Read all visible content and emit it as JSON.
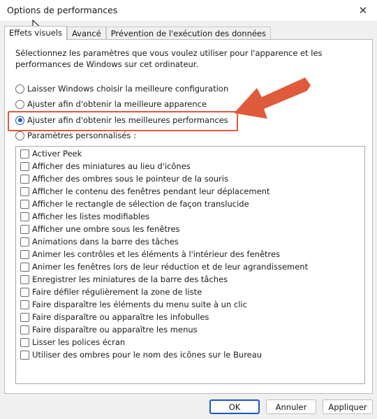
{
  "window": {
    "title": "Options de performances",
    "close_icon": "close-icon"
  },
  "tabs": [
    {
      "label": "Effets visuels",
      "active": true
    },
    {
      "label": "Avancé",
      "active": false
    },
    {
      "label": "Prévention de l'exécution des données",
      "active": false
    }
  ],
  "intro": "Sélectionnez les paramètres que vous voulez utiliser pour l'apparence et les performances de Windows sur cet ordinateur.",
  "options": [
    {
      "label": "Laisser Windows choisir la meilleure configuration",
      "selected": false
    },
    {
      "label": "Ajuster afin d'obtenir la meilleure apparence",
      "selected": false
    },
    {
      "label": "Ajuster afin d'obtenir les meilleures performances",
      "selected": true
    },
    {
      "label": "Paramètres personnalisés :",
      "selected": false
    }
  ],
  "effects": [
    {
      "label": "Activer Peek",
      "checked": false
    },
    {
      "label": "Afficher des miniatures au lieu d'icônes",
      "checked": false
    },
    {
      "label": "Afficher des ombres sous le pointeur de la souris",
      "checked": false
    },
    {
      "label": "Afficher le contenu des fenêtres pendant leur déplacement",
      "checked": false
    },
    {
      "label": "Afficher le rectangle de sélection de façon translucide",
      "checked": false
    },
    {
      "label": "Afficher les listes modifiables",
      "checked": false
    },
    {
      "label": "Afficher une ombre sous les fenêtres",
      "checked": false
    },
    {
      "label": "Animations dans la barre des tâches",
      "checked": false
    },
    {
      "label": "Animer les contrôles et les éléments à l'intérieur des fenêtres",
      "checked": false
    },
    {
      "label": "Animer les fenêtres lors de leur réduction et de leur agrandissement",
      "checked": false
    },
    {
      "label": "Enregistrer les miniatures de la barre des tâches",
      "checked": false
    },
    {
      "label": "Faire défiler régulièrement la zone de liste",
      "checked": false
    },
    {
      "label": "Faire disparaître les éléments du menu suite à un clic",
      "checked": false
    },
    {
      "label": "Faire disparaître ou apparaître les infobulles",
      "checked": false
    },
    {
      "label": "Faire disparaître ou apparaître les menus",
      "checked": false
    },
    {
      "label": "Lisser les polices écran",
      "checked": false
    },
    {
      "label": "Utiliser des ombres pour le nom des icônes sur le Bureau",
      "checked": false
    }
  ],
  "buttons": {
    "ok": "OK",
    "cancel": "Annuler",
    "apply": "Appliquer"
  },
  "colors": {
    "accent": "#1a57c8",
    "annotation": "#e05a3c"
  }
}
